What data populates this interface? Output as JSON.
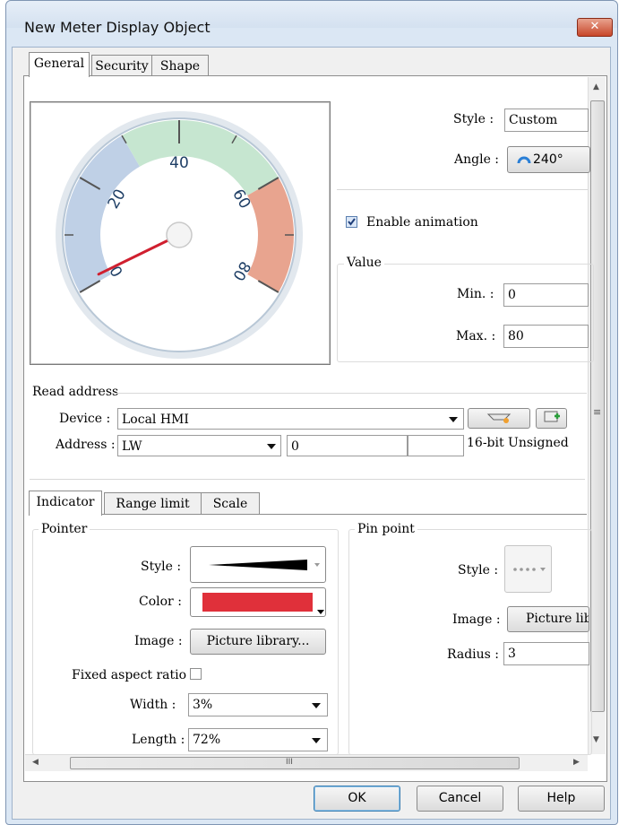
{
  "window": {
    "title": "New Meter Display Object",
    "close_glyph": "✕"
  },
  "tabs": [
    "General",
    "Security",
    "Shape"
  ],
  "meter": {
    "ticks": [
      "0",
      "20",
      "40",
      "60",
      "80"
    ],
    "value": 0
  },
  "appearance": {
    "style_label": "Style :",
    "style_value": "Custom",
    "angle_label": "Angle :",
    "angle_value": "240°",
    "enable_animation_label": "Enable animation",
    "enable_animation_checked": true
  },
  "value_group": {
    "title": "Value",
    "min_label": "Min. :",
    "min_value": "0",
    "max_label": "Max. :",
    "max_value": "80"
  },
  "read_address": {
    "title": "Read address",
    "device_label": "Device :",
    "device_value": "Local HMI",
    "address_label": "Address :",
    "address_type": "LW",
    "address_value": "0",
    "format": "16-bit Unsigned"
  },
  "subtabs": [
    "Indicator",
    "Range limit",
    "Scale"
  ],
  "pointer": {
    "title": "Pointer",
    "style_label": "Style :",
    "color_label": "Color :",
    "color": "#e0303a",
    "image_label": "Image :",
    "image_button": "Picture library...",
    "fixed_aspect_label": "Fixed aspect ratio :",
    "fixed_aspect_checked": false,
    "width_label": "Width :",
    "width_value": "3%",
    "length_label": "Length :",
    "length_value": "72%"
  },
  "pin_point": {
    "title": "Pin point",
    "style_label": "Style :",
    "image_label": "Image :",
    "image_button": "Picture lib",
    "radius_label": "Radius :",
    "radius_value": "3"
  },
  "hscroll_mark": "III",
  "buttons": {
    "ok": "OK",
    "cancel": "Cancel",
    "help": "Help"
  },
  "colors": {
    "range_low": "#bfd0e6",
    "range_mid": "#c6e6d0",
    "range_high": "#e8a48f",
    "pointer": "#d01f2f"
  }
}
